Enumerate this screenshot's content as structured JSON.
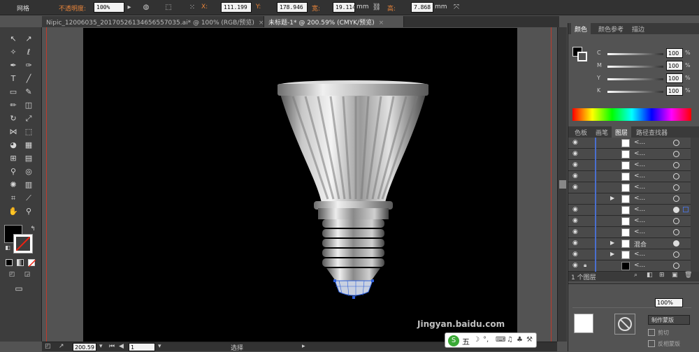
{
  "control_bar": {
    "style_label": "网格",
    "opacity_label": "不透明度:",
    "opacity_value": "100%",
    "x_label": "X:",
    "x_value": "111.199",
    "y_label": "Y:",
    "y_value": "178.946",
    "w_label": "宽:",
    "w_value": "19.114",
    "w_unit": "mm",
    "h_label": "高:",
    "h_value": "7.868",
    "h_unit": "mm"
  },
  "tabs": [
    {
      "label": "Nipic_12006035_20170526134656557035.ai* @ 100% (RGB/预览)",
      "close": "×"
    },
    {
      "label": "未标题-1* @ 200.59% (CMYK/预览)",
      "close": "×"
    }
  ],
  "color_panel": {
    "tabs": [
      "颜色",
      "颜色参考",
      "描边"
    ],
    "channels": [
      {
        "name": "C",
        "value": "100",
        "unit": "%"
      },
      {
        "name": "M",
        "value": "100",
        "unit": "%"
      },
      {
        "name": "Y",
        "value": "100",
        "unit": "%"
      },
      {
        "name": "K",
        "value": "100",
        "unit": "%"
      }
    ]
  },
  "layers_panel": {
    "tabs": [
      "色板",
      "画笔",
      "图层",
      "路径查找器"
    ],
    "rows": [
      {
        "name": "<...",
        "expand": ""
      },
      {
        "name": "<...",
        "expand": ""
      },
      {
        "name": "<...",
        "expand": ""
      },
      {
        "name": "<...",
        "expand": ""
      },
      {
        "name": "<...",
        "expand": ""
      },
      {
        "name": "<...",
        "expand": "▶"
      },
      {
        "name": "<...",
        "expand": ""
      },
      {
        "name": "<...",
        "expand": ""
      },
      {
        "name": "<...",
        "expand": ""
      },
      {
        "name": "混合",
        "expand": "▶"
      },
      {
        "name": "<...",
        "expand": "▶"
      },
      {
        "name": "<...",
        "expand": ""
      }
    ],
    "footer": "1 个图层"
  },
  "transparency_panel": {
    "opacity_value": "100%",
    "make_mask": "制作蒙版",
    "clip": "剪切",
    "invert_mask": "反相蒙版"
  },
  "status_bar": {
    "zoom": "200.59",
    "page": "1",
    "tool_name": "选择"
  },
  "ime_bar": {
    "mode": "五"
  },
  "watermark": "Jingyan.baidu.com"
}
